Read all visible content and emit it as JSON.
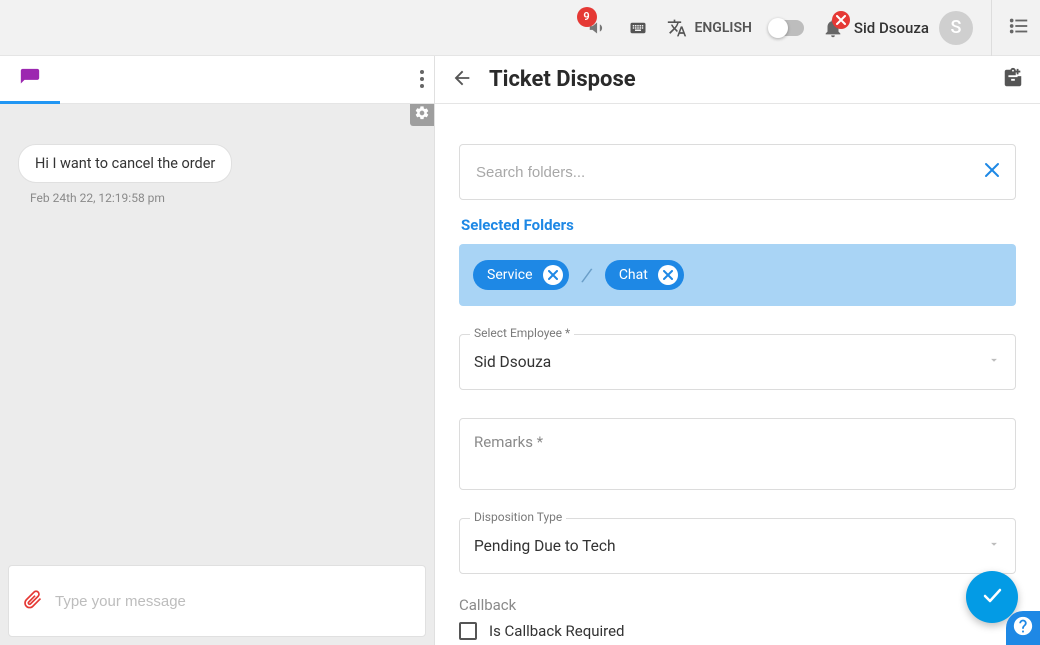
{
  "header": {
    "notifications_count": "9",
    "language_label": "ENGLISH",
    "user_name": "Sid Dsouza",
    "avatar_initial": "S"
  },
  "chat": {
    "message_text": "Hi I want to cancel the order",
    "message_time": "Feb 24th 22, 12:19:58 pm",
    "composer_placeholder": "Type your message"
  },
  "panel": {
    "title": "Ticket Dispose",
    "search_placeholder": "Search folders...",
    "selected_folders_label": "Selected Folders",
    "chips": [
      "Service",
      "Chat"
    ],
    "employee": {
      "label": "Select Employee *",
      "value": "Sid Dsouza"
    },
    "remarks": {
      "label": "Remarks *",
      "placeholder": "Remarks *"
    },
    "disposition": {
      "label": "Disposition Type",
      "value": "Pending Due to Tech"
    },
    "callback": {
      "label": "Callback",
      "checkbox_label": "Is Callback Required"
    }
  }
}
